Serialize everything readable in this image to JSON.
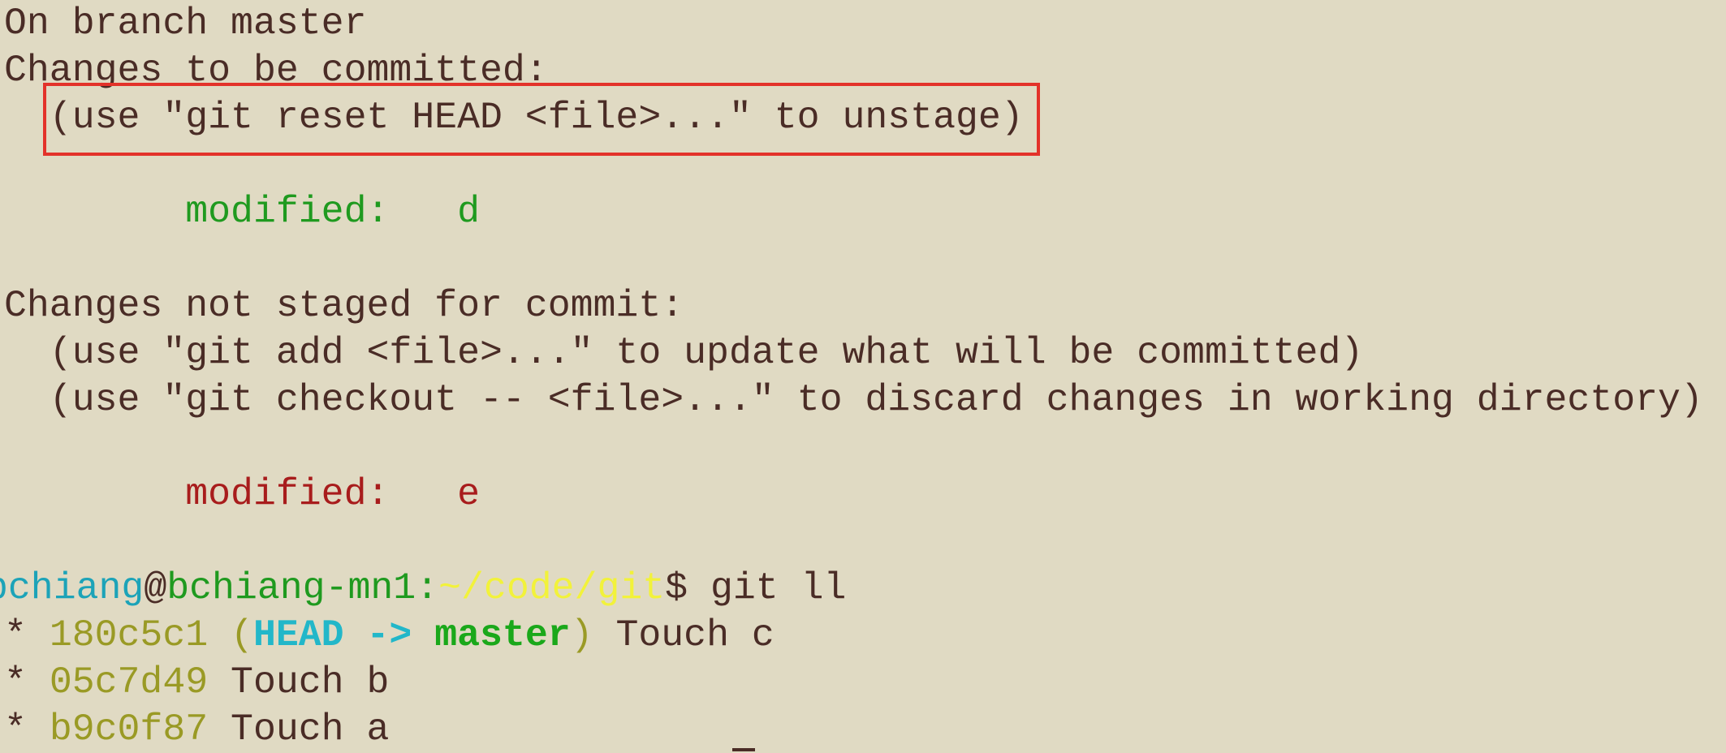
{
  "terminal": {
    "status_lines": {
      "branch": "On branch master",
      "staged_header": "Changes to be committed:",
      "staged_hint": "  (use \"git reset HEAD <file>...\" to unstage)",
      "staged_file_label": "        modified:   ",
      "staged_file_name": "d",
      "unstaged_header": "Changes not staged for commit:",
      "unstaged_hint_add": "  (use \"git add <file>...\" to update what will be committed)",
      "unstaged_hint_checkout": "  (use \"git checkout -- <file>...\" to discard changes in working directory)",
      "unstaged_file_label": "        modified:   ",
      "unstaged_file_name": "e"
    },
    "prompt": {
      "user": "bchiang",
      "at": "@",
      "host": "bchiang-mn1",
      "colon": ":",
      "path": "~/code/git",
      "symbol": "$ ",
      "command": "git ll"
    },
    "log": [
      {
        "bullet": "* ",
        "hash": "180c5c1",
        "refs_open": " (",
        "head": "HEAD",
        "arrow": " -> ",
        "branch": "master",
        "refs_close": ")",
        "message": " Touch c"
      },
      {
        "bullet": "* ",
        "hash": "05c7d49",
        "message": " Touch b"
      },
      {
        "bullet": "* ",
        "hash": "b9c0f87",
        "message": " Touch a"
      }
    ]
  },
  "colors": {
    "background": "#e0dac3",
    "text": "#4a2c26",
    "staged_green": "#1f9a1f",
    "unstaged_red": "#a81c1c",
    "user_cyan": "#1ca3b8",
    "path_yellow": "#f2f23a",
    "hash_olive": "#9a9a25",
    "highlight_red": "#e3322a"
  }
}
